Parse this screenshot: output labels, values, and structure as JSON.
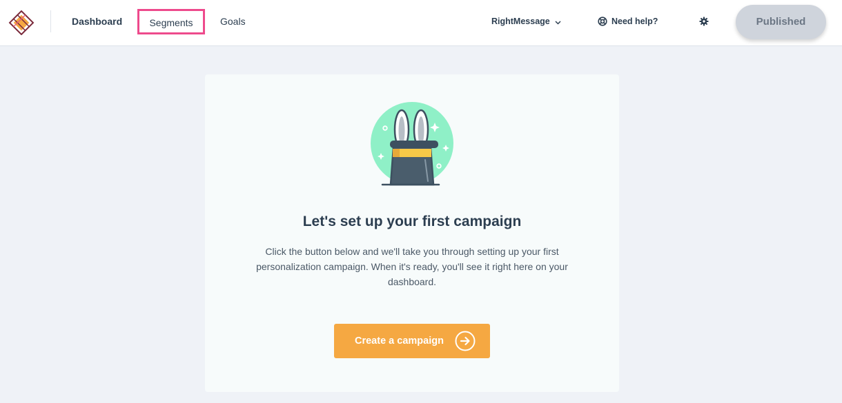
{
  "header": {
    "logo_icon": "rightmessage-logo-icon",
    "nav": [
      {
        "label": "Dashboard"
      },
      {
        "label": "Segments"
      },
      {
        "label": "Goals"
      }
    ],
    "account_label": "RightMessage",
    "account_icon": "chevron-down-icon",
    "help_label": "Need help?",
    "help_icon": "lifebuoy-icon",
    "settings_icon": "gear-icon",
    "publish_label": "Published"
  },
  "empty_state": {
    "illustration_icon": "magic-hat-rabbit-icon",
    "title": "Let's set up your first campaign",
    "description": "Click the button below and we'll take you through setting up your first personalization campaign. When it's ready, you'll see it right here on your dashboard.",
    "cta_label": "Create a campaign",
    "cta_icon": "arrow-right-circle-icon"
  },
  "colors": {
    "accent": "#f5a842",
    "highlight_border": "#ee4a8c",
    "background": "#eff2f7",
    "card": "#f7fbfb",
    "text": "#2c3e50"
  }
}
